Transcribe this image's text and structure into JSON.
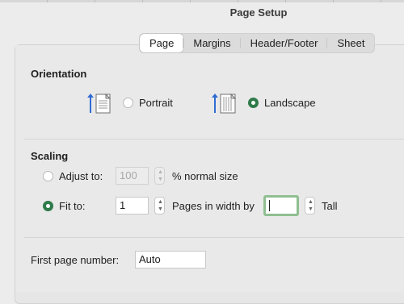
{
  "window": {
    "title": "Page Setup"
  },
  "tabs": [
    {
      "label": "Page",
      "active": true
    },
    {
      "label": "Margins",
      "active": false
    },
    {
      "label": "Header/Footer",
      "active": false
    },
    {
      "label": "Sheet",
      "active": false
    }
  ],
  "orientation": {
    "heading": "Orientation",
    "portrait_label": "Portrait",
    "landscape_label": "Landscape",
    "selected": "Landscape"
  },
  "scaling": {
    "heading": "Scaling",
    "adjust_to_label": "Adjust to:",
    "adjust_value": "100",
    "normal_size_label": "% normal size",
    "fit_to_label": "Fit to:",
    "pages_wide_value": "1",
    "pages_in_width_by_label": "Pages in width by",
    "tall_value": "",
    "tall_label": "Tall",
    "selected": "Fit to:"
  },
  "first_page": {
    "label": "First page number:",
    "value": "Auto"
  },
  "colors": {
    "accent_green": "#2f7a4a",
    "focus_ring": "#8fbf90",
    "icon_blue": "#2e6bd3"
  },
  "icons": [
    "portrait-orientation-icon",
    "landscape-orientation-icon"
  ]
}
